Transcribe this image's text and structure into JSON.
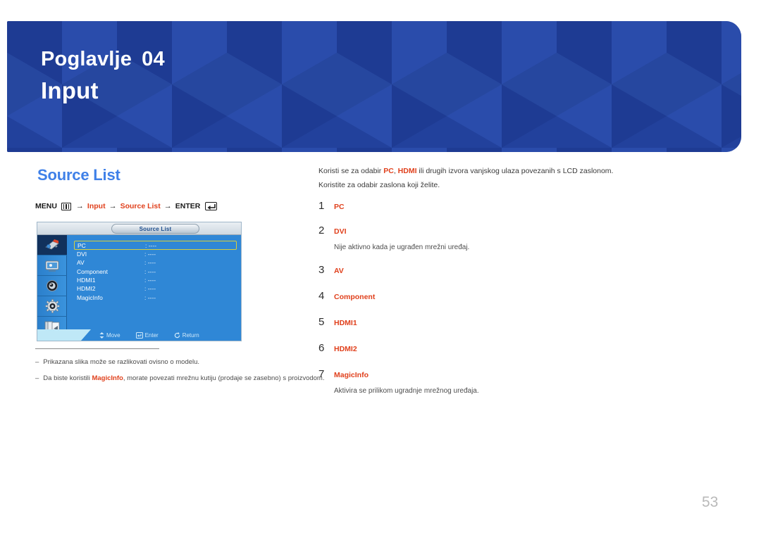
{
  "banner": {
    "chapter_label": "Poglavlje",
    "chapter_number": "04",
    "title": "Input",
    "bg_color": "#22419c"
  },
  "section": {
    "title": "Source List",
    "title_color": "#3f80e8"
  },
  "menu_path": {
    "menu_label": "MENU",
    "menu_icon": "menu-bars-icon",
    "arrow": "→",
    "step1": "Input",
    "step2": "Source List",
    "enter_label": "ENTER",
    "enter_icon": "enter-key-icon",
    "highlight_color": "#e0401c"
  },
  "osd": {
    "title": "Source List",
    "sidebar_icons": [
      "input-source-icon",
      "picture-icon",
      "sound-icon",
      "setup-gear-icon",
      "multi-control-icon"
    ],
    "rows": [
      {
        "label": "PC",
        "value": ": ----",
        "selected": true
      },
      {
        "label": "DVI",
        "value": ": ----",
        "selected": false
      },
      {
        "label": "AV",
        "value": ": ----",
        "selected": false
      },
      {
        "label": "Component",
        "value": ": ----",
        "selected": false
      },
      {
        "label": "HDMI1",
        "value": ": ----",
        "selected": false
      },
      {
        "label": "HDMI2",
        "value": ": ----",
        "selected": false
      },
      {
        "label": "MagicInfo",
        "value": ": ----",
        "selected": false
      }
    ],
    "footer": {
      "move": "Move",
      "enter": "Enter",
      "return": "Return"
    },
    "selection_border_color": "#d8cf3c",
    "bg_color": "#2f87d6"
  },
  "footnotes": [
    {
      "dash": "–",
      "text": "Prikazana slika može se razlikovati ovisno o modelu."
    },
    {
      "dash": "–",
      "prefix": "Da biste koristili ",
      "bold": "MagicInfo",
      "suffix": ", morate povezati mrežnu kutiju (prodaje se zasebno) s proizvodom."
    }
  ],
  "right_column": {
    "intro": {
      "line1_part1": "Koristi se za odabir ",
      "line1_bold1": "PC",
      "line1_part2": ", ",
      "line1_bold2": "HDMI",
      "line1_part3": " ili drugih izvora vanjskog ulaza povezanih s LCD zaslonom.",
      "line2": "Koristite za odabir zaslona koji želite."
    },
    "items": [
      {
        "number": "1",
        "label": "PC",
        "desc": ""
      },
      {
        "number": "2",
        "label": "DVI",
        "desc": "Nije aktivno kada je ugrađen mrežni uređaj."
      },
      {
        "number": "3",
        "label": "AV",
        "desc": ""
      },
      {
        "number": "4",
        "label": "Component",
        "desc": ""
      },
      {
        "number": "5",
        "label": "HDMI1",
        "desc": ""
      },
      {
        "number": "6",
        "label": "HDMI2",
        "desc": ""
      },
      {
        "number": "7",
        "label": "MagicInfo",
        "desc": "Aktivira se prilikom ugradnje mrežnog uređaja."
      }
    ],
    "label_color": "#e0401c"
  },
  "page_number": "53"
}
